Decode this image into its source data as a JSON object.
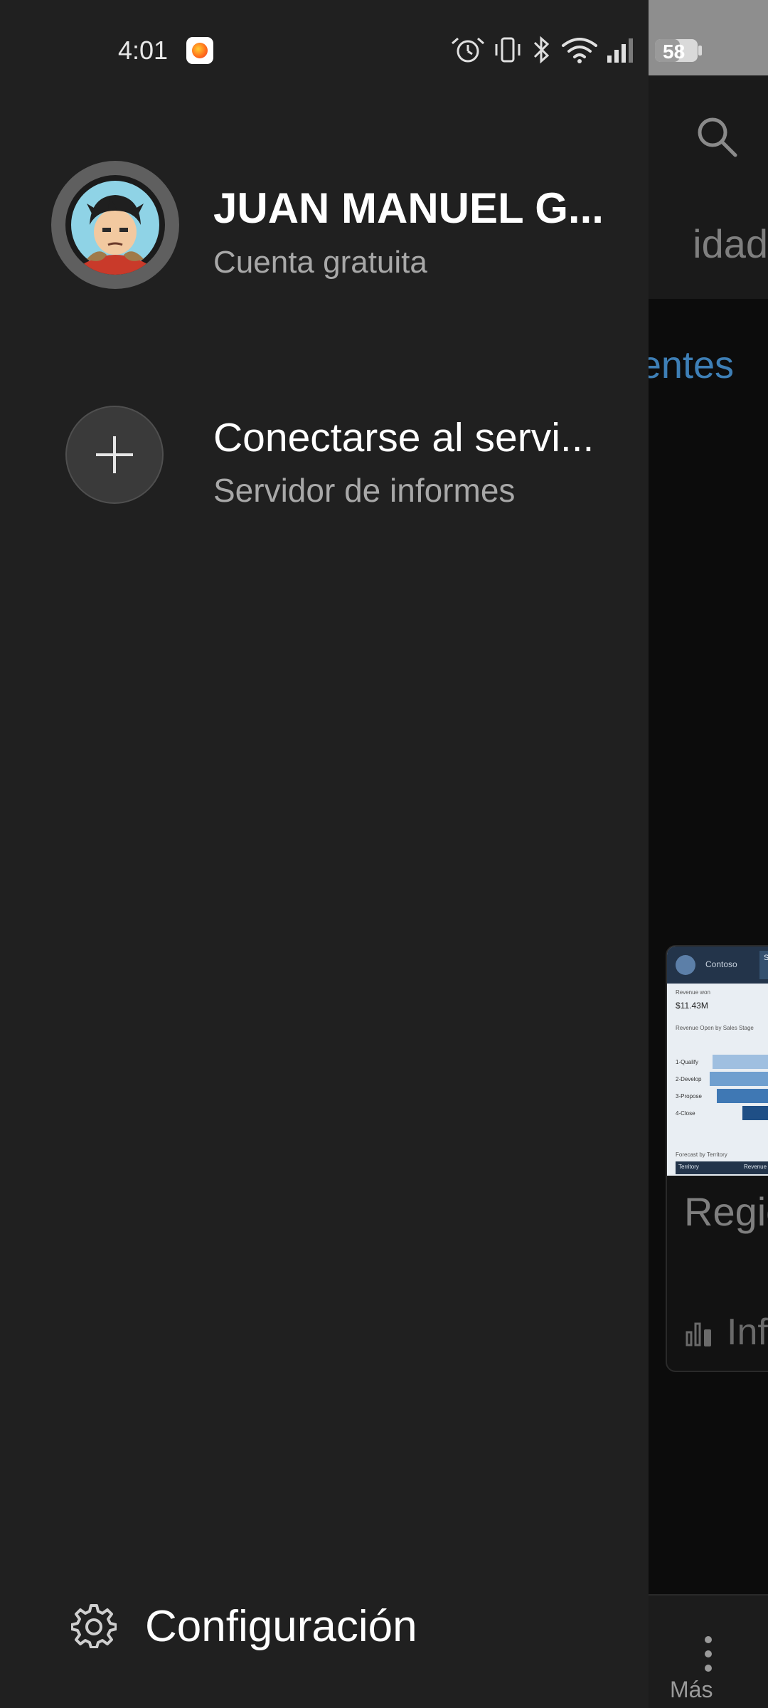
{
  "status_bar": {
    "time": "4:01",
    "battery": "58"
  },
  "background_app": {
    "tab_partial": "idad",
    "link_partial": "entes",
    "card": {
      "thumbnail": {
        "brand": "Contoso",
        "tag": "SA",
        "kpi_label": "Revenue won",
        "kpi_value": "$11.43M",
        "chart_title": "Revenue Open by Sales Stage",
        "categories": [
          "1-Qualify",
          "2-Develop",
          "3-Propose",
          "4-Close"
        ],
        "footer_title": "Forecast by Territory",
        "footer_col1": "Territory",
        "footer_col2": "Revenue W"
      },
      "title_partial": "Regio",
      "type_partial": "Info"
    },
    "more_label": "Más"
  },
  "drawer": {
    "profile": {
      "name": "JUAN MANUEL G...",
      "subtitle": "Cuenta gratuita"
    },
    "connect": {
      "title": "Conectarse al servi...",
      "subtitle": "Servidor de informes"
    },
    "settings": {
      "label": "Configuración"
    }
  }
}
